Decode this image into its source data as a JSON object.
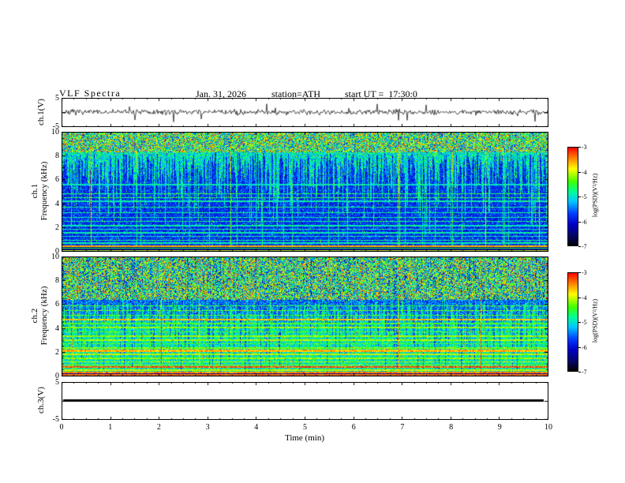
{
  "header": {
    "title": "VLF Spectra",
    "date": "Jan. 31, 2026",
    "station": "station=ATH",
    "start_ut": "start UT =  17:30:0"
  },
  "xaxis": {
    "label": "Time  (min)",
    "lim": [
      0,
      10
    ],
    "ticks": [
      0,
      1,
      2,
      3,
      4,
      5,
      6,
      7,
      8,
      9,
      10
    ]
  },
  "colormap": {
    "range_log_psd": [
      -7,
      -3
    ],
    "stops": [
      [
        0.0,
        0,
        0,
        0
      ],
      [
        0.1,
        5,
        5,
        100
      ],
      [
        0.22,
        0,
        0,
        200
      ],
      [
        0.33,
        0,
        64,
        255
      ],
      [
        0.45,
        0,
        200,
        255
      ],
      [
        0.55,
        0,
        255,
        150
      ],
      [
        0.65,
        64,
        255,
        0
      ],
      [
        0.78,
        255,
        255,
        0
      ],
      [
        0.88,
        255,
        140,
        0
      ],
      [
        1.0,
        255,
        0,
        0
      ]
    ]
  },
  "chart_data": [
    {
      "type": "line",
      "name": "ch1_waveform",
      "ylabel": "ch.1(V)",
      "ylim": [
        -5,
        5
      ],
      "ytick_labels": [
        5,
        -5
      ],
      "description": "noisy broadband waveform near 0 V with impulsive sferic spikes up to about +/-3 V",
      "noise_std": 0.45,
      "spike_prob": 0.015,
      "spike_amp": 3.0,
      "seed": 7
    },
    {
      "type": "heatmap",
      "name": "ch1_spectrogram",
      "ylabel_line1": "ch.1",
      "ylabel_line2": "Frequency (kHz)",
      "ylim": [
        0,
        10
      ],
      "yticks": [
        0,
        2,
        4,
        6,
        8,
        10
      ],
      "xlim_min": [
        0,
        10
      ],
      "seed": 21,
      "description": "VLF spectrogram: dense green/yellow speckle above ~8.3 kHz, blue background below with green vertical streaks descending, narrow cyan horizontal lines, dark band near 0 kHz with bright lines",
      "top_band": {
        "f_min": 8.3,
        "base": 0.6,
        "noise": 0.33,
        "col_var": 0.12
      },
      "background": {
        "base": 0.3,
        "noise": 0.11,
        "speck_prob": 0.035
      },
      "streaks": {
        "mean_depth_khz": 2.4,
        "boost": 0.2,
        "full_column_prob": 0.02
      },
      "hlines": [
        [
          5.6,
          0.5,
          0.04
        ],
        [
          4.85,
          0.58,
          0.05
        ],
        [
          4.5,
          0.6,
          0.05
        ],
        [
          4.2,
          0.52,
          0.04
        ],
        [
          3.7,
          0.56,
          0.05
        ],
        [
          3.25,
          0.54,
          0.04
        ],
        [
          2.85,
          0.52,
          0.04
        ],
        [
          2.5,
          0.55,
          0.04
        ],
        [
          2.15,
          0.52,
          0.04
        ],
        [
          1.85,
          0.5,
          0.04
        ],
        [
          1.55,
          0.52,
          0.04
        ],
        [
          1.25,
          0.5,
          0.04
        ],
        [
          0.95,
          0.55,
          0.04
        ],
        [
          0.7,
          0.52,
          0.04
        ]
      ],
      "bottom_band": {
        "f_max": 0.5,
        "base": 0.14,
        "lines": [
          [
            0.42,
            0.85,
            0.05
          ],
          [
            0.28,
            0.6,
            0.04
          ],
          [
            0.08,
            0.75,
            0.05
          ]
        ]
      },
      "colorbar": {
        "label": "log(PSD)(V²/Hz)",
        "ticks": [
          -3,
          -4,
          -5,
          -6,
          -7
        ],
        "range": [
          -7,
          -3
        ]
      }
    },
    {
      "type": "heatmap",
      "name": "ch2_spectrogram",
      "ylabel_line1": "ch.2",
      "ylabel_line2": "Frequency (kHz)",
      "ylim": [
        0,
        10
      ],
      "yticks": [
        0,
        2,
        4,
        6,
        8,
        10
      ],
      "seed": 31,
      "description": "VLF spectrogram: speckled green/blue above ~6.4 kHz with dark vertical streaks, green background below with many yellow/red horizontal emission bands, strong red band near 0.75 kHz",
      "top_band": {
        "f_min": 6.4,
        "base": 0.57,
        "noise": 0.35,
        "col_var": 0.22
      },
      "background": {
        "base": 0.52,
        "noise": 0.13,
        "speck_prob": 0.03
      },
      "streaks": {
        "mean_depth_khz": 1.8,
        "boost": -0.16,
        "full_column_prob": 0.015
      },
      "hlines": [
        [
          5.9,
          0.62,
          0.05
        ],
        [
          5.5,
          0.66,
          0.06
        ],
        [
          5.1,
          0.64,
          0.05
        ],
        [
          4.75,
          0.82,
          0.08
        ],
        [
          4.4,
          0.64,
          0.05
        ],
        [
          4.05,
          0.7,
          0.06
        ],
        [
          3.7,
          0.66,
          0.05
        ],
        [
          3.35,
          0.7,
          0.05
        ],
        [
          3.0,
          0.72,
          0.06
        ],
        [
          2.7,
          0.64,
          0.05
        ],
        [
          2.35,
          0.68,
          0.05
        ],
        [
          2.1,
          0.84,
          0.11
        ],
        [
          1.8,
          0.74,
          0.06
        ],
        [
          1.5,
          0.7,
          0.05
        ],
        [
          1.2,
          0.72,
          0.05
        ],
        [
          0.95,
          0.7,
          0.04
        ],
        [
          0.75,
          0.92,
          0.06
        ],
        [
          0.5,
          0.74,
          0.04
        ],
        [
          0.3,
          0.88,
          0.05
        ]
      ],
      "bottom_band": {
        "f_max": 0.2,
        "base": 0.18,
        "lines": [
          [
            0.1,
            0.9,
            0.05
          ]
        ]
      },
      "colorbar": {
        "label": "log(PSD)(V²/Hz)",
        "ticks": [
          -3,
          -4,
          -5,
          -6,
          -7
        ],
        "range": [
          -7,
          -3
        ]
      }
    },
    {
      "type": "line",
      "name": "ch3_flat",
      "ylabel": "ch.3(V)",
      "ylim": [
        -5,
        5
      ],
      "ytick_labels": [
        5,
        -5
      ],
      "description": "flat thick black trace at 0 V (no signal)",
      "flat_value": 0,
      "line_width": 3
    }
  ]
}
